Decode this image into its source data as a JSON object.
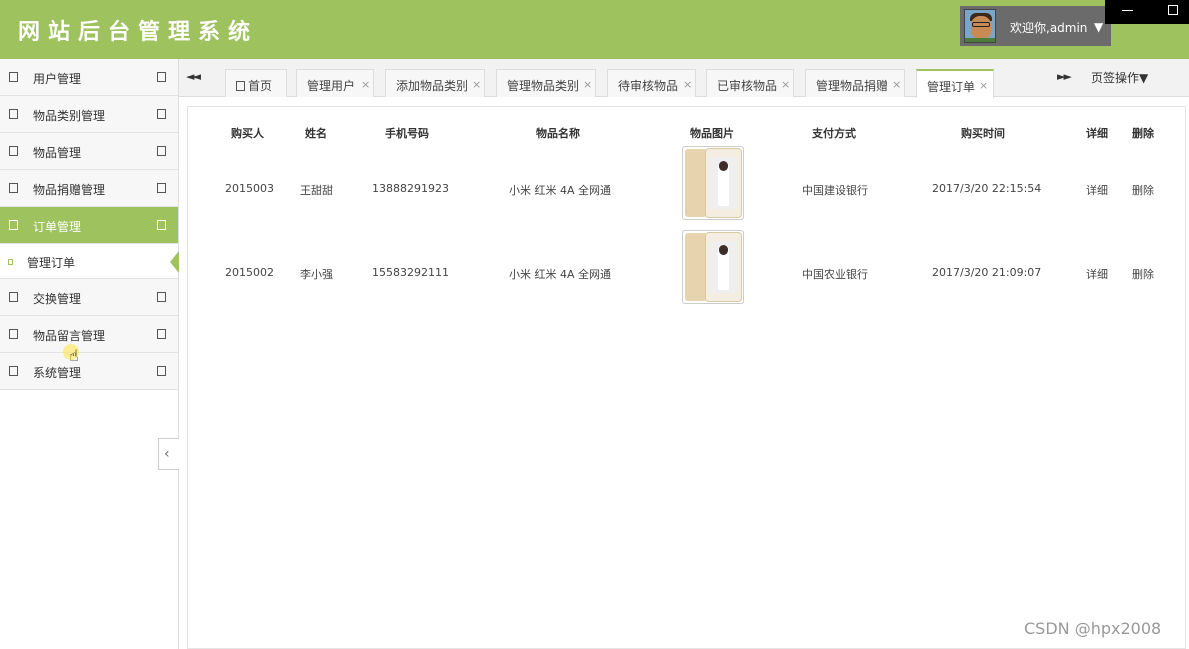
{
  "app": {
    "title": "网站后台管理系统",
    "welcome": "欢迎你,admin",
    "user_caret": "▼"
  },
  "sidebar": {
    "items": [
      {
        "label": "用户管理"
      },
      {
        "label": "物品类别管理"
      },
      {
        "label": "物品管理"
      },
      {
        "label": "物品捐赠管理"
      },
      {
        "label": "订单管理",
        "active": true
      },
      {
        "label": "交换管理"
      },
      {
        "label": "物品留言管理"
      },
      {
        "label": "系统管理"
      }
    ],
    "submenu": {
      "label": "管理订单"
    },
    "collapse_icon": "‹"
  },
  "tabs": {
    "prev": "◄◄",
    "next": "►►",
    "page_ops": "页签操作▼",
    "items": [
      {
        "label": "首页"
      },
      {
        "label": "管理用户"
      },
      {
        "label": "添加物品类别"
      },
      {
        "label": "管理物品类别"
      },
      {
        "label": "待审核物品"
      },
      {
        "label": "已审核物品"
      },
      {
        "label": "管理物品捐赠"
      },
      {
        "label": "管理订单",
        "active": true
      }
    ],
    "close": "×"
  },
  "table": {
    "headers": [
      "购买人",
      "姓名",
      "手机号码",
      "物品名称",
      "物品图片",
      "支付方式",
      "购买时间",
      "详细",
      "删除"
    ],
    "rows": [
      {
        "buyer": "2015003",
        "name": "王甜甜",
        "phone": "13888291923",
        "item": "小米 红米 4A 全网通",
        "payment": "中国建设银行",
        "time": "2017/3/20 22:15:54",
        "detail": "详细",
        "delete": "删除"
      },
      {
        "buyer": "2015002",
        "name": "李小强",
        "phone": "15583292111",
        "item": "小米 红米 4A 全网通",
        "payment": "中国农业银行",
        "time": "2017/3/20 21:09:07",
        "detail": "详细",
        "delete": "删除"
      }
    ]
  },
  "watermark": "CSDN @hpx2008",
  "colors": {
    "accent": "#9dc25e",
    "user_box": "#6b6b6b"
  }
}
